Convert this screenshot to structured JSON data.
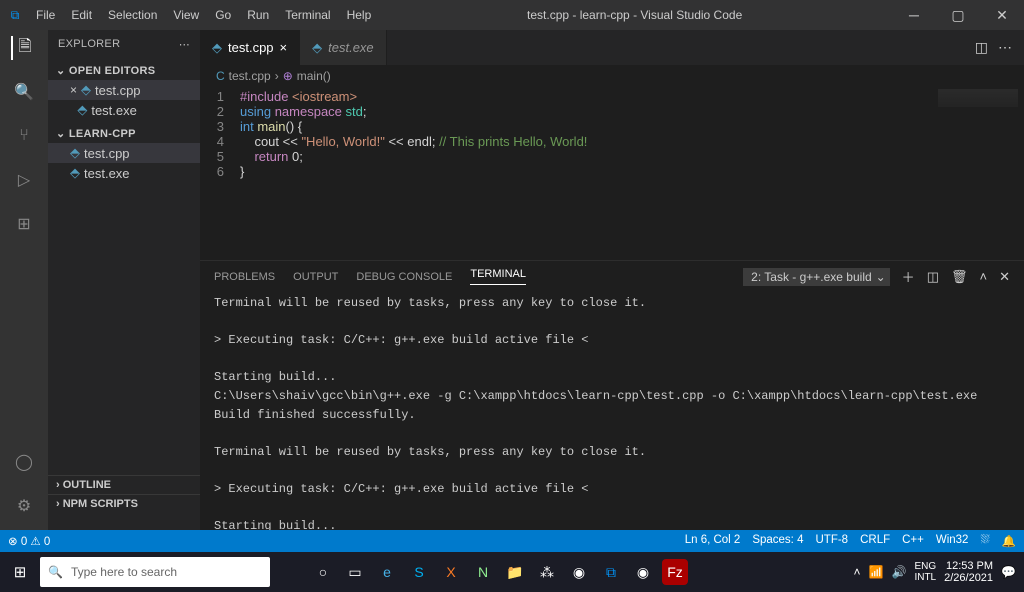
{
  "title": "test.cpp - learn-cpp - Visual Studio Code",
  "menu": [
    "File",
    "Edit",
    "Selection",
    "View",
    "Go",
    "Run",
    "Terminal",
    "Help"
  ],
  "explorer": {
    "title": "EXPLORER",
    "open_editors": "OPEN EDITORS",
    "project": "LEARN-CPP",
    "items_open": [
      {
        "name": "test.cpp",
        "close": "×"
      },
      {
        "name": "test.exe",
        "close": ""
      }
    ],
    "items_proj": [
      {
        "name": "test.cpp"
      },
      {
        "name": "test.exe"
      }
    ],
    "outline": "OUTLINE",
    "npm": "NPM SCRIPTS"
  },
  "tabs": [
    {
      "name": "test.cpp",
      "active": true,
      "close": "×"
    },
    {
      "name": "test.exe",
      "active": false,
      "italic": true
    }
  ],
  "breadcrumb": {
    "file": "test.cpp",
    "symbol": "main()"
  },
  "code": [
    {
      "n": "1",
      "seg": [
        [
          "kw",
          "#include "
        ],
        [
          "str",
          "<iostream>"
        ]
      ]
    },
    {
      "n": "2",
      "seg": [
        [
          "typ",
          "using "
        ],
        [
          "kw",
          "namespace "
        ],
        [
          "ns",
          "std"
        ],
        [
          "op",
          ";"
        ]
      ]
    },
    {
      "n": "3",
      "seg": [
        [
          "typ",
          "int "
        ],
        [
          "fn",
          "main"
        ],
        [
          "op",
          "() {"
        ]
      ]
    },
    {
      "n": "4",
      "seg": [
        [
          "op",
          "    cout "
        ],
        [
          "op",
          "<< "
        ],
        [
          "str",
          "\"Hello, World!\""
        ],
        [
          "op",
          " << endl; "
        ],
        [
          "cm",
          "// This prints Hello, World!"
        ]
      ]
    },
    {
      "n": "5",
      "seg": [
        [
          "kw",
          "    return "
        ],
        [
          "op",
          "0;"
        ]
      ]
    },
    {
      "n": "6",
      "seg": [
        [
          "op",
          "}"
        ]
      ]
    }
  ],
  "panel": {
    "tabs": [
      "PROBLEMS",
      "OUTPUT",
      "DEBUG CONSOLE",
      "TERMINAL"
    ],
    "active": 3,
    "dropdown": "2: Task - g++.exe build",
    "terminal_text": "Terminal will be reused by tasks, press any key to close it.\n\n> Executing task: C/C++: g++.exe build active file <\n\nStarting build...\nC:\\Users\\shaiv\\gcc\\bin\\g++.exe -g C:\\xampp\\htdocs\\learn-cpp\\test.cpp -o C:\\xampp\\htdocs\\learn-cpp\\test.exe\nBuild finished successfully.\n\nTerminal will be reused by tasks, press any key to close it.\n\n> Executing task: C/C++: g++.exe build active file <\n\nStarting build...\nC:\\Users\\shaiv\\gcc\\bin\\g++.exe -g C:\\xampp\\htdocs\\learn-cpp\\test.cpp -o C:\\xampp\\htdocs\\learn-cpp\\test.exe\nBuild finished successfully.\n\nTerminal will be reused by tasks, press any key to close it."
  },
  "status": {
    "left": [
      "⊗ 0 ⚠ 0"
    ],
    "right": [
      "Ln 6, Col 2",
      "Spaces: 4",
      "UTF-8",
      "CRLF",
      "C++",
      "Win32",
      "⛆",
      "🔔"
    ]
  },
  "taskbar": {
    "search_placeholder": "Type here to search",
    "time": "12:53 PM",
    "date": "2/26/2021",
    "lang1": "ENG",
    "lang2": "INTL"
  }
}
